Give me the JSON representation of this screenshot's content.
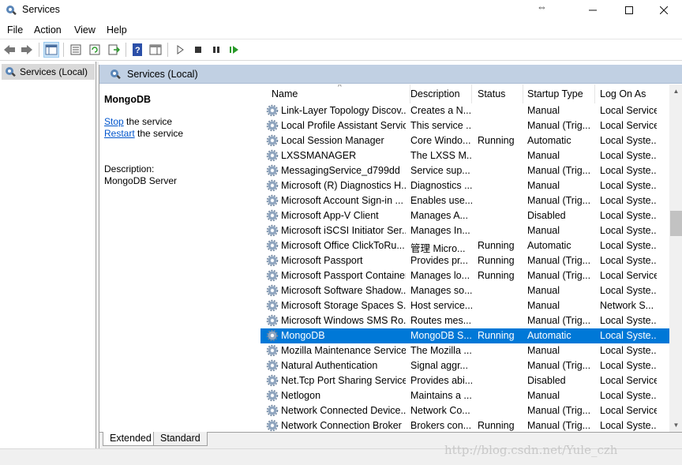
{
  "window": {
    "title": "Services",
    "icon": "services-gear-icon"
  },
  "menu": [
    "File",
    "Action",
    "View",
    "Help"
  ],
  "tree": {
    "selected_label": "Services (Local)"
  },
  "pane": {
    "header": "Services (Local)",
    "service_title": "MongoDB",
    "stop_link": "Stop",
    "stop_rest": " the service",
    "restart_link": "Restart",
    "restart_rest": " the service",
    "desc_label": "Description:",
    "desc_value": "MongoDB Server"
  },
  "columns": {
    "name": "Name",
    "description": "Description",
    "status": "Status",
    "startup": "Startup Type",
    "logon": "Log On As"
  },
  "services": [
    {
      "name": "Link-Layer Topology Discov...",
      "description": "Creates a N...",
      "status": "",
      "startup": "Manual",
      "logon": "Local Service"
    },
    {
      "name": "Local Profile Assistant Service",
      "description": "This service ...",
      "status": "",
      "startup": "Manual (Trig...",
      "logon": "Local Service"
    },
    {
      "name": "Local Session Manager",
      "description": "Core Windo...",
      "status": "Running",
      "startup": "Automatic",
      "logon": "Local Syste..."
    },
    {
      "name": "LXSSMANAGER",
      "description": "The LXSS M...",
      "status": "",
      "startup": "Manual",
      "logon": "Local Syste..."
    },
    {
      "name": "MessagingService_d799dd",
      "description": "Service sup...",
      "status": "",
      "startup": "Manual (Trig...",
      "logon": "Local Syste..."
    },
    {
      "name": "Microsoft (R) Diagnostics H...",
      "description": "Diagnostics ...",
      "status": "",
      "startup": "Manual",
      "logon": "Local Syste..."
    },
    {
      "name": "Microsoft Account Sign-in ...",
      "description": "Enables use...",
      "status": "",
      "startup": "Manual (Trig...",
      "logon": "Local Syste..."
    },
    {
      "name": "Microsoft App-V Client",
      "description": "Manages A...",
      "status": "",
      "startup": "Disabled",
      "logon": "Local Syste..."
    },
    {
      "name": "Microsoft iSCSI Initiator Ser...",
      "description": "Manages In...",
      "status": "",
      "startup": "Manual",
      "logon": "Local Syste..."
    },
    {
      "name": "Microsoft Office ClickToRu...",
      "description": "管理 Micro...",
      "status": "Running",
      "startup": "Automatic",
      "logon": "Local Syste..."
    },
    {
      "name": "Microsoft Passport",
      "description": "Provides pr...",
      "status": "Running",
      "startup": "Manual (Trig...",
      "logon": "Local Syste..."
    },
    {
      "name": "Microsoft Passport Container",
      "description": "Manages lo...",
      "status": "Running",
      "startup": "Manual (Trig...",
      "logon": "Local Service"
    },
    {
      "name": "Microsoft Software Shadow...",
      "description": "Manages so...",
      "status": "",
      "startup": "Manual",
      "logon": "Local Syste..."
    },
    {
      "name": "Microsoft Storage Spaces S...",
      "description": "Host service...",
      "status": "",
      "startup": "Manual",
      "logon": "Network S..."
    },
    {
      "name": "Microsoft Windows SMS Ro...",
      "description": "Routes mes...",
      "status": "",
      "startup": "Manual (Trig...",
      "logon": "Local Syste..."
    },
    {
      "name": "MongoDB",
      "description": "MongoDB S...",
      "status": "Running",
      "startup": "Automatic",
      "logon": "Local Syste...",
      "selected": true
    },
    {
      "name": "Mozilla Maintenance Service",
      "description": "The Mozilla ...",
      "status": "",
      "startup": "Manual",
      "logon": "Local Syste..."
    },
    {
      "name": "Natural Authentication",
      "description": "Signal aggr...",
      "status": "",
      "startup": "Manual (Trig...",
      "logon": "Local Syste..."
    },
    {
      "name": "Net.Tcp Port Sharing Service",
      "description": "Provides abi...",
      "status": "",
      "startup": "Disabled",
      "logon": "Local Service"
    },
    {
      "name": "Netlogon",
      "description": "Maintains a ...",
      "status": "",
      "startup": "Manual",
      "logon": "Local Syste..."
    },
    {
      "name": "Network Connected Device...",
      "description": "Network Co...",
      "status": "",
      "startup": "Manual (Trig...",
      "logon": "Local Service"
    },
    {
      "name": "Network Connection Broker",
      "description": "Brokers con...",
      "status": "Running",
      "startup": "Manual (Trig...",
      "logon": "Local Syste..."
    }
  ],
  "tabs": {
    "extended": "Extended",
    "standard": "Standard"
  },
  "watermark": "http://blog.csdn.net/Yule_czh"
}
